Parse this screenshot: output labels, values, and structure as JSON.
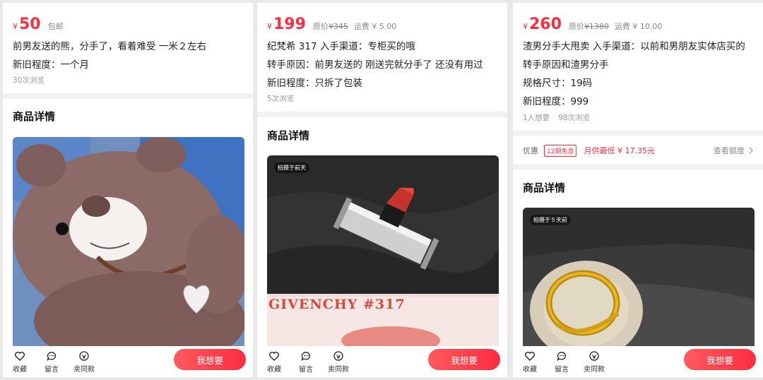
{
  "currency": "¥",
  "colors": {
    "accent": "#ff2d3f",
    "muted": "#9a9a9a"
  },
  "listings": [
    {
      "price": "50",
      "shipping": "包邮",
      "title": "前男友送的熊，分手了，看着难受 一米２左右",
      "condition": "新旧程度：一个月",
      "views": "30次浏览",
      "detail_title": "商品详情",
      "photo_subject": "teddy-bear"
    },
    {
      "price": "199",
      "original_label": "原价",
      "original_price": "¥345",
      "shipping": "运费 ¥ 5.00",
      "title": "纪梵希 317 入手渠道：专柜买的哦",
      "reason": "转手原因：前男友送的 刚送完就分手了 还没有用过",
      "condition": "新旧程度：只拆了包装",
      "views": "5次浏览",
      "detail_title": "商品详情",
      "photo_tag": "拍摄于前天",
      "photo_caption": "GIVENCHY #317",
      "photo_subject": "lipstick"
    },
    {
      "price": "260",
      "original_label": "原价",
      "original_price": "¥1380",
      "shipping": "运费 ¥ 10.00",
      "title": "渣男分手大甩卖 入手渠道：以前和男朋友实体店买的",
      "reason": "转手原因和渣男分手",
      "size": "规格尺寸：19码",
      "condition": "新旧程度：999",
      "wants": "1人想要",
      "views": "98次浏览",
      "promo_label": "优惠",
      "promo_badge": "12期免息",
      "promo_monthly": "月供最低 ¥ 17.35元",
      "promo_link": "查看额度",
      "detail_title": "商品详情",
      "photo_tag": "拍摄于５天前",
      "photo_subject": "gold-ring"
    }
  ],
  "actions": {
    "favorite": "收藏",
    "comment": "留言",
    "sell_similar": "卖同款",
    "want": "我想要"
  },
  "icons": [
    "heart-icon",
    "comment-icon",
    "sell-similar-icon",
    "chevron-right-icon"
  ]
}
